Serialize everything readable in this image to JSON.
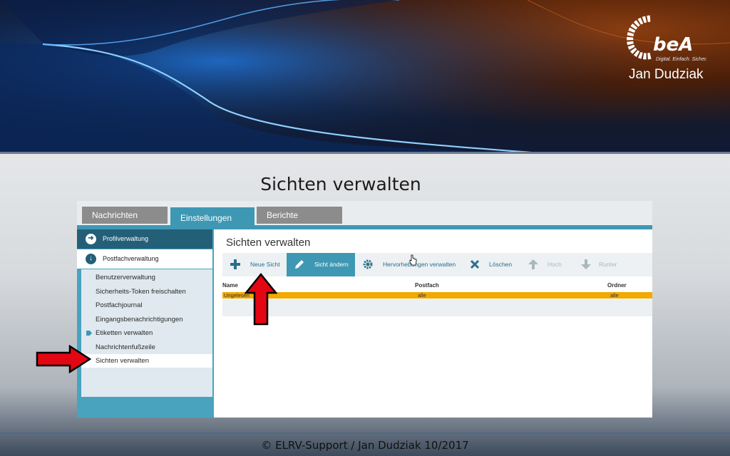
{
  "logo": {
    "wordmark": "beA",
    "tagline": "Digital. Einfach. Sicher.",
    "author": "Jan Dudziak"
  },
  "slide": {
    "title": "Sichten verwalten",
    "footer": "© ELRV-Support / Jan Dudziak 10/2017"
  },
  "app": {
    "tabs": [
      {
        "label": "Nachrichten",
        "active": false
      },
      {
        "label": "Einstellungen",
        "active": true
      },
      {
        "label": "Berichte",
        "active": false
      }
    ],
    "sidebar": {
      "top_items": [
        {
          "label": "Profilverwaltung",
          "icon": "arrow-right-circle-icon"
        },
        {
          "label": "Postfachverwaltung",
          "icon": "arrow-down-circle-icon"
        }
      ],
      "items": [
        {
          "label": "Benutzerverwaltung"
        },
        {
          "label": "Sicherheits-Token freischalten"
        },
        {
          "label": "Postfachjournal"
        },
        {
          "label": "Eingangsbenachrichtigungen"
        },
        {
          "label": "Etiketten verwalten",
          "icon": "tag-icon"
        },
        {
          "label": "Nachrichtenfußzeile"
        },
        {
          "label": "Sichten verwalten",
          "active": true
        }
      ]
    },
    "main": {
      "title": "Sichten verwalten",
      "toolbar": [
        {
          "label": "Neue Sicht",
          "icon": "plus-icon",
          "state": "normal"
        },
        {
          "label": "Sicht ändern",
          "icon": "pencil-icon",
          "state": "active"
        },
        {
          "label": "Hervorhebungen verwalten",
          "icon": "gear-icon",
          "state": "normal"
        },
        {
          "label": "Löschen",
          "icon": "x-icon",
          "state": "normal"
        },
        {
          "label": "Hoch",
          "icon": "arrow-up-icon",
          "state": "disabled"
        },
        {
          "label": "Runter",
          "icon": "arrow-down-icon",
          "state": "disabled"
        }
      ],
      "columns": [
        "Name",
        "Postfach",
        "Ordner"
      ],
      "rows": [
        {
          "name": "Ungelesen",
          "postfach": "alle",
          "ordner": "alle"
        }
      ]
    }
  },
  "colors": {
    "accent": "#3e98b4",
    "sidebar_dark": "#245f78",
    "highlight_row": "#f2a900",
    "annotation_arrow": "#e30613"
  }
}
